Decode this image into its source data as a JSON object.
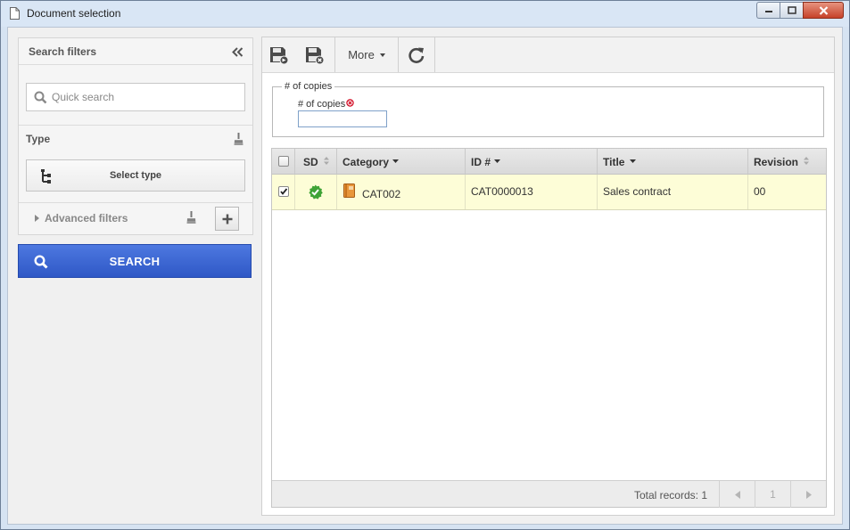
{
  "window": {
    "title": "Document selection",
    "icon": "document-icon"
  },
  "filters": {
    "header": "Search filters",
    "quick_search_placeholder": "Quick search",
    "type_label": "Type",
    "select_type_label": "Select type",
    "advanced_label": "Advanced filters",
    "search_button": "SEARCH"
  },
  "toolbar": {
    "more_label": "More",
    "icons": [
      "save-new-icon",
      "save-close-icon",
      "refresh-icon"
    ]
  },
  "copies": {
    "legend": "# of copies",
    "label": "# of copies",
    "value": ""
  },
  "grid": {
    "columns": [
      "SD",
      "Category",
      "ID #",
      "Title",
      "Revision"
    ],
    "rows": [
      {
        "checked": true,
        "sd_icon": "approved-badge-icon",
        "category": "CAT002",
        "id": "CAT0000013",
        "title": "Sales contract",
        "revision": "00"
      }
    ],
    "total_records": "Total records: 1",
    "page": "1"
  },
  "colors": {
    "search_button": "#3a62cf",
    "selected_row": "#fdfdd7",
    "required": "#d0021b",
    "approved": "#3fa336"
  }
}
